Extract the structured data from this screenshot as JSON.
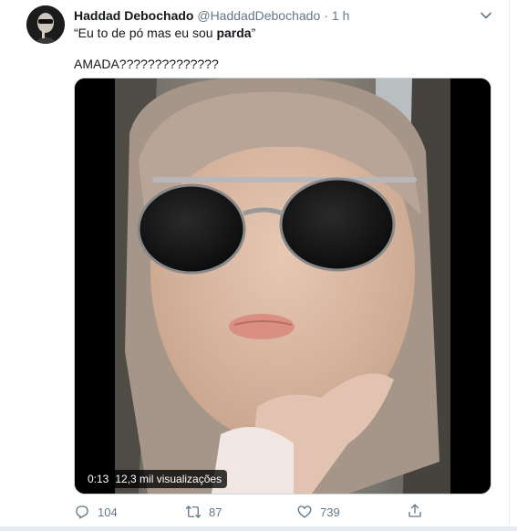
{
  "tweet": {
    "author_name": "Haddad Debochado",
    "author_handle": "@HaddadDebochado",
    "separator": "·",
    "timestamp": "1 h",
    "quote_open": "“Eu to de pó mas eu sou ",
    "quote_bold": "parda",
    "quote_close": "”",
    "body": "AMADA??????????????",
    "media": {
      "type": "video",
      "elapsed": "0:13",
      "views": "12,3 mil visualizações"
    },
    "actions": {
      "reply_count": "104",
      "retweet_count": "87",
      "like_count": "739"
    }
  },
  "colors": {
    "text_primary": "#14171a",
    "text_secondary": "#657786",
    "divider": "#e6ecf0"
  },
  "icons": {
    "caret": "chevron-down-icon",
    "reply": "reply-icon",
    "retweet": "retweet-icon",
    "like": "heart-icon",
    "share": "share-icon"
  }
}
